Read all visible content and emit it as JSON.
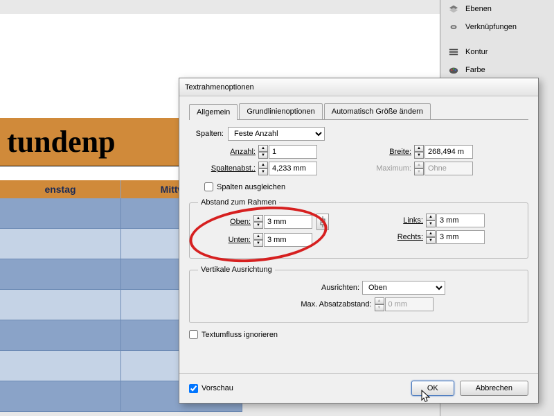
{
  "side_panel": {
    "items": [
      "Ebenen",
      "Verknüpfungen",
      "Kontur",
      "Farbe"
    ]
  },
  "document": {
    "title_fragment": "tundenp",
    "headers": [
      "enstag",
      "Mittwoch"
    ]
  },
  "dialog": {
    "title": "Textrahmenoptionen",
    "tabs": [
      "Allgemein",
      "Grundlinienoptionen",
      "Automatisch Größe ändern"
    ],
    "columns": {
      "label": "Spalten:",
      "value": "Feste Anzahl",
      "count_label": "Anzahl:",
      "count_value": "1",
      "gutter_label": "Spaltenabst.:",
      "gutter_value": "4,233 mm",
      "width_label": "Breite:",
      "width_value": "268,494 m",
      "max_label": "Maximum:",
      "max_value": "Ohne",
      "balance_label": "Spalten ausgleichen"
    },
    "inset": {
      "legend": "Abstand zum Rahmen",
      "top_label": "Oben:",
      "top_value": "3 mm",
      "bottom_label": "Unten:",
      "bottom_value": "3 mm",
      "left_label": "Links:",
      "left_value": "3 mm",
      "right_label": "Rechts:",
      "right_value": "3 mm"
    },
    "vert": {
      "legend": "Vertikale Ausrichtung",
      "align_label": "Ausrichten:",
      "align_value": "Oben",
      "para_label": "Max. Absatzabstand:",
      "para_value": "0 mm"
    },
    "ignore_wrap": "Textumfluss ignorieren",
    "preview": "Vorschau",
    "ok": "OK",
    "cancel": "Abbrechen"
  }
}
